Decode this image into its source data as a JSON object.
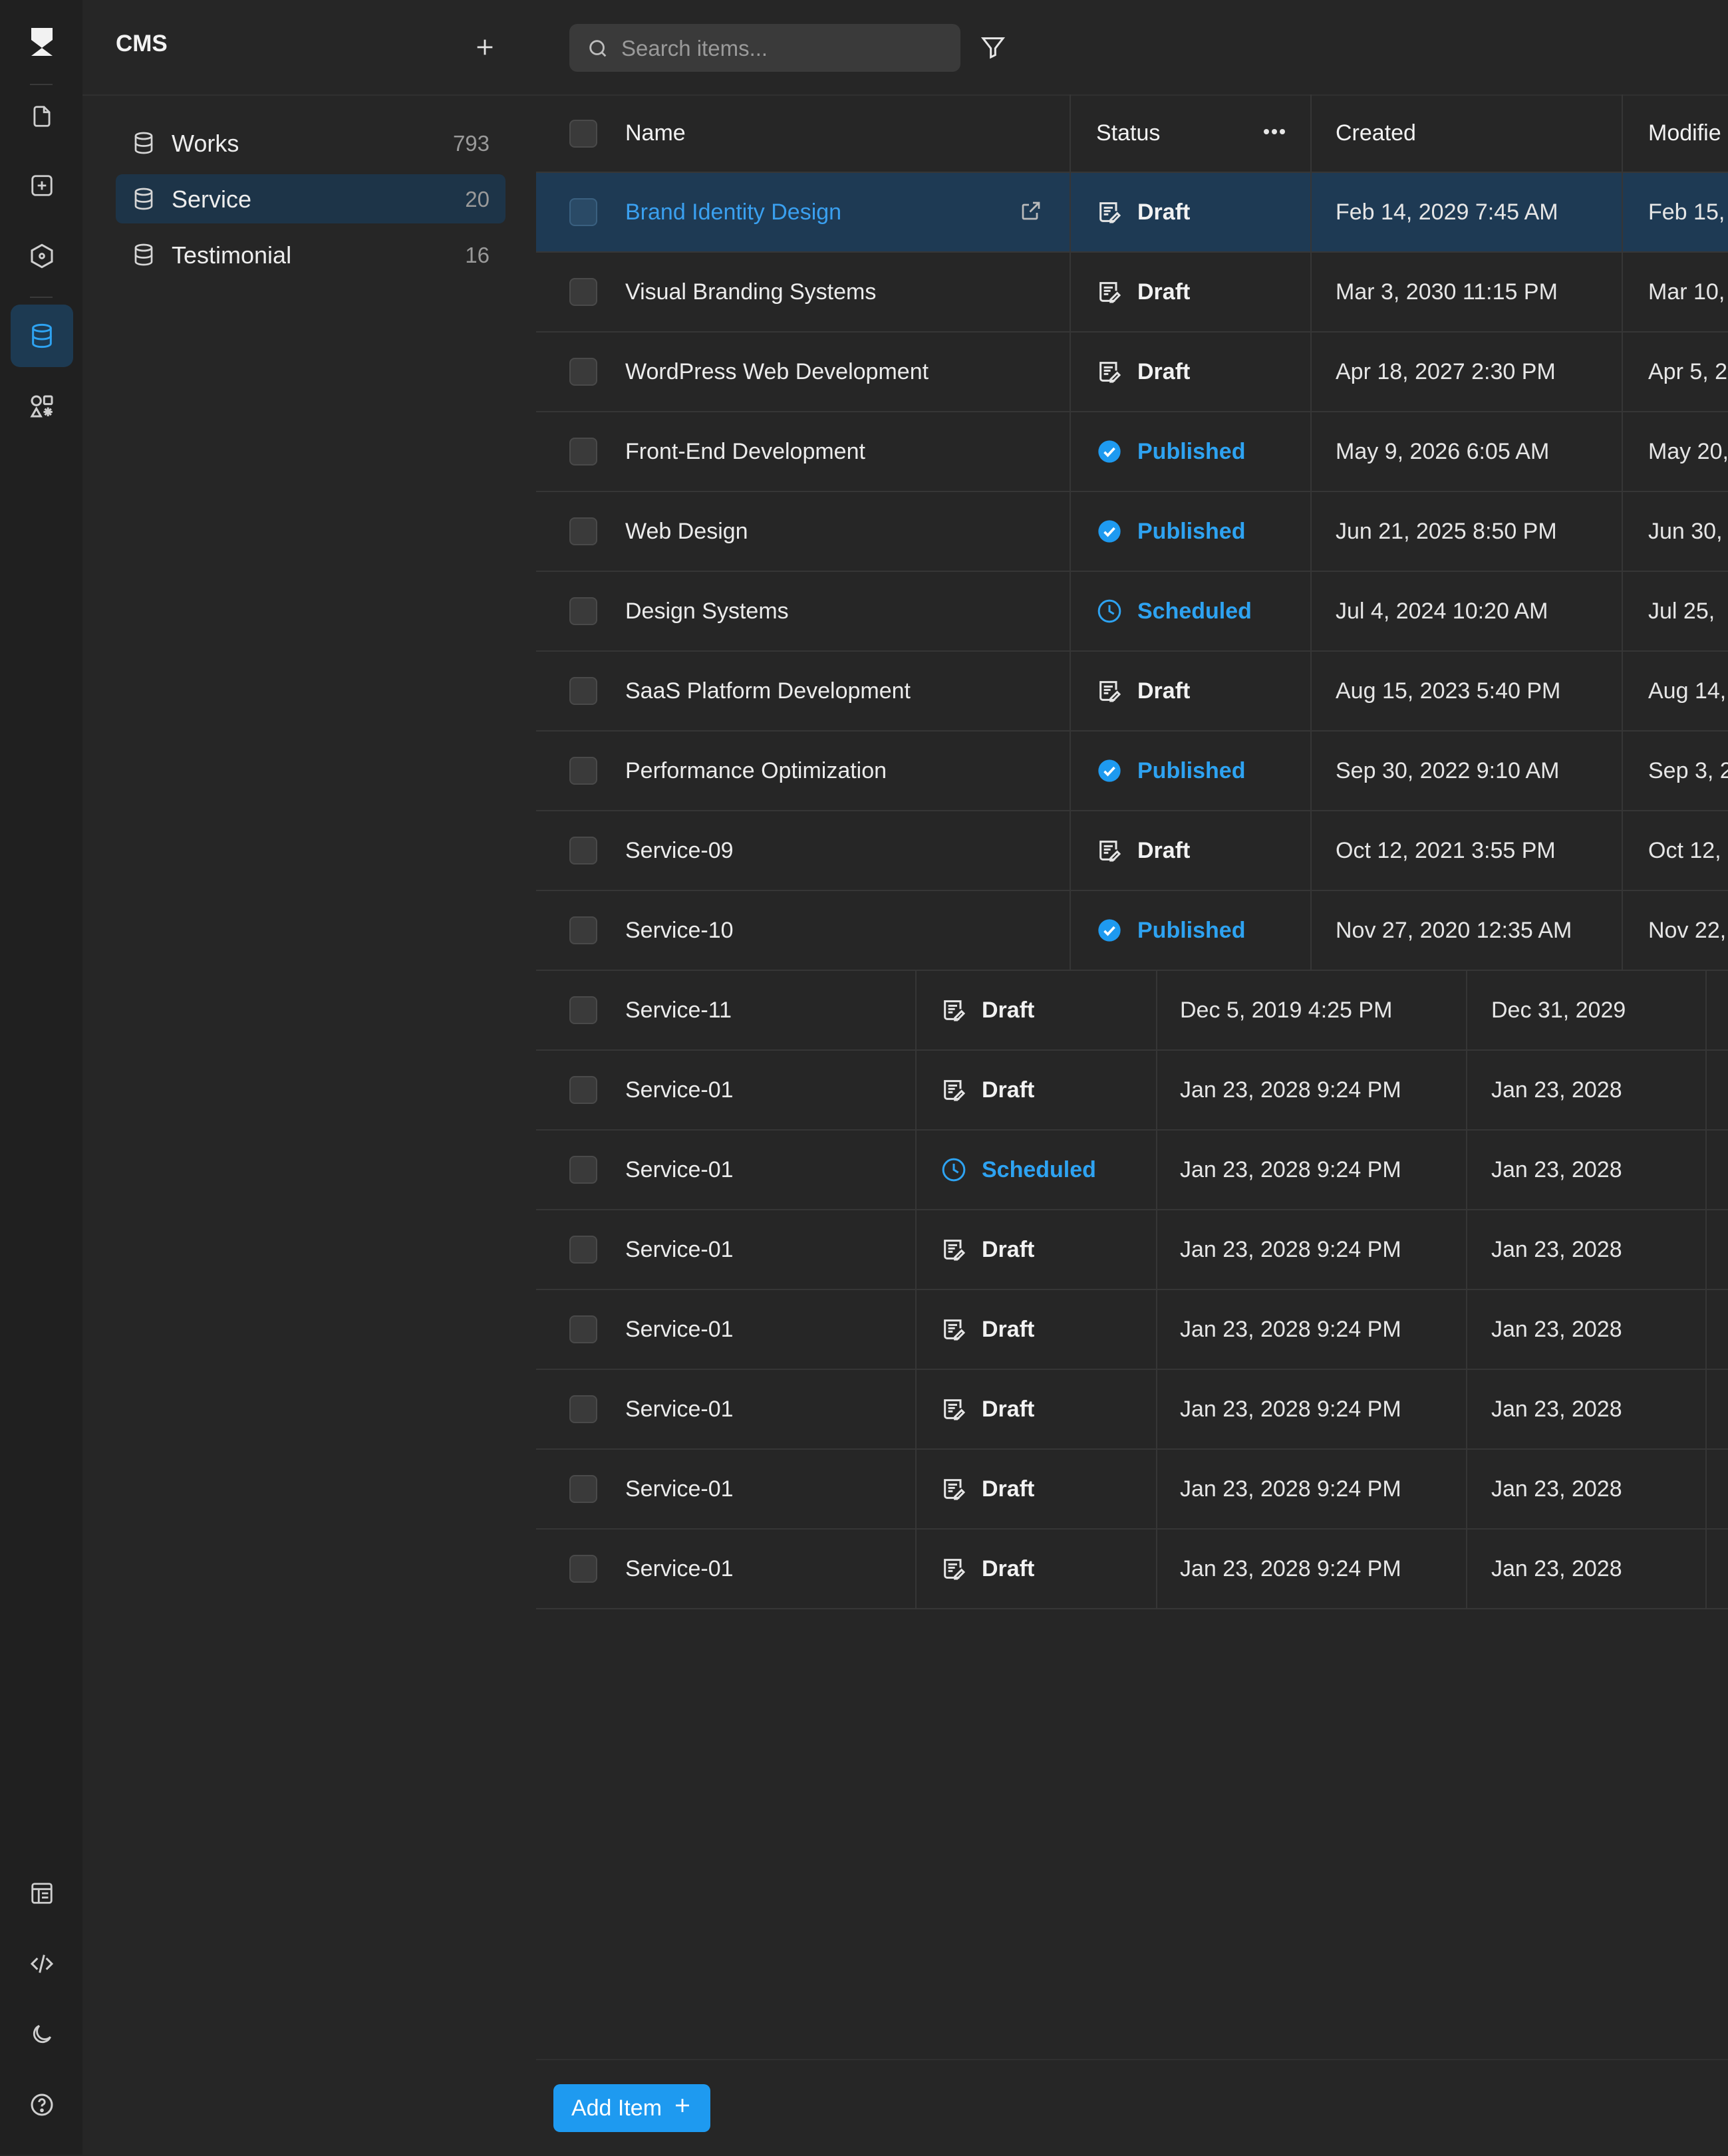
{
  "sidebar": {
    "title": "CMS",
    "collections": [
      {
        "label": "Works",
        "count": "793"
      },
      {
        "label": "Service",
        "count": "20"
      },
      {
        "label": "Testimonial",
        "count": "16"
      }
    ]
  },
  "search": {
    "placeholder": "Search items..."
  },
  "table": {
    "columns": {
      "name": "Name",
      "status": "Status",
      "created": "Created",
      "modified": "Modifie"
    },
    "rows": [
      {
        "name": "Brand Identity Design",
        "status": "Draft",
        "created": "Feb 14, 2029 7:45 AM",
        "modified": "Feb 15,"
      },
      {
        "name": "Visual Branding Systems",
        "status": "Draft",
        "created": "Mar 3, 2030 11:15 PM",
        "modified": "Mar 10,"
      },
      {
        "name": "WordPress Web Development",
        "status": "Draft",
        "created": "Apr 18, 2027 2:30 PM",
        "modified": "Apr 5, 2"
      },
      {
        "name": "Front-End Development",
        "status": "Published",
        "created": "May 9, 2026 6:05 AM",
        "modified": "May 20,"
      },
      {
        "name": "Web Design",
        "status": "Published",
        "created": "Jun 21, 2025 8:50 PM",
        "modified": "Jun 30,"
      },
      {
        "name": "Design Systems",
        "status": "Scheduled",
        "created": "Jul 4, 2024 10:20 AM",
        "modified": "Jul 25,"
      },
      {
        "name": "SaaS Platform Development",
        "status": "Draft",
        "created": "Aug 15, 2023 5:40 PM",
        "modified": "Aug 14,"
      },
      {
        "name": "Performance Optimization",
        "status": "Published",
        "created": "Sep 30, 2022 9:10 AM",
        "modified": "Sep 3, 2"
      },
      {
        "name": "Service-09",
        "status": "Draft",
        "created": "Oct 12, 2021 3:55 PM",
        "modified": "Oct 12,"
      },
      {
        "name": "Service-10",
        "status": "Published",
        "created": "Nov 27, 2020 12:35 AM",
        "modified": "Nov 22,"
      },
      {
        "name": "Service-11",
        "status": "Draft",
        "created": "Dec 5, 2019 4:25 PM",
        "modified": "Dec 31, 2029"
      },
      {
        "name": "Service-01",
        "status": "Draft",
        "created": "Jan 23, 2028 9:24 PM",
        "modified": "Jan 23, 2028"
      },
      {
        "name": "Service-01",
        "status": "Scheduled",
        "created": "Jan 23, 2028 9:24 PM",
        "modified": "Jan 23, 2028"
      },
      {
        "name": "Service-01",
        "status": "Draft",
        "created": "Jan 23, 2028 9:24 PM",
        "modified": "Jan 23, 2028"
      },
      {
        "name": "Service-01",
        "status": "Draft",
        "created": "Jan 23, 2028 9:24 PM",
        "modified": "Jan 23, 2028"
      },
      {
        "name": "Service-01",
        "status": "Draft",
        "created": "Jan 23, 2028 9:24 PM",
        "modified": "Jan 23, 2028"
      },
      {
        "name": "Service-01",
        "status": "Draft",
        "created": "Jan 23, 2028 9:24 PM",
        "modified": "Jan 23, 2028"
      },
      {
        "name": "Service-01",
        "status": "Draft",
        "created": "Jan 23, 2028 9:24 PM",
        "modified": "Jan 23, 2028"
      }
    ]
  },
  "footer": {
    "add_label": "Add Item"
  },
  "colors": {
    "accent": "#1e9af0",
    "selected_row": "#1e3a54",
    "background": "#262626"
  }
}
